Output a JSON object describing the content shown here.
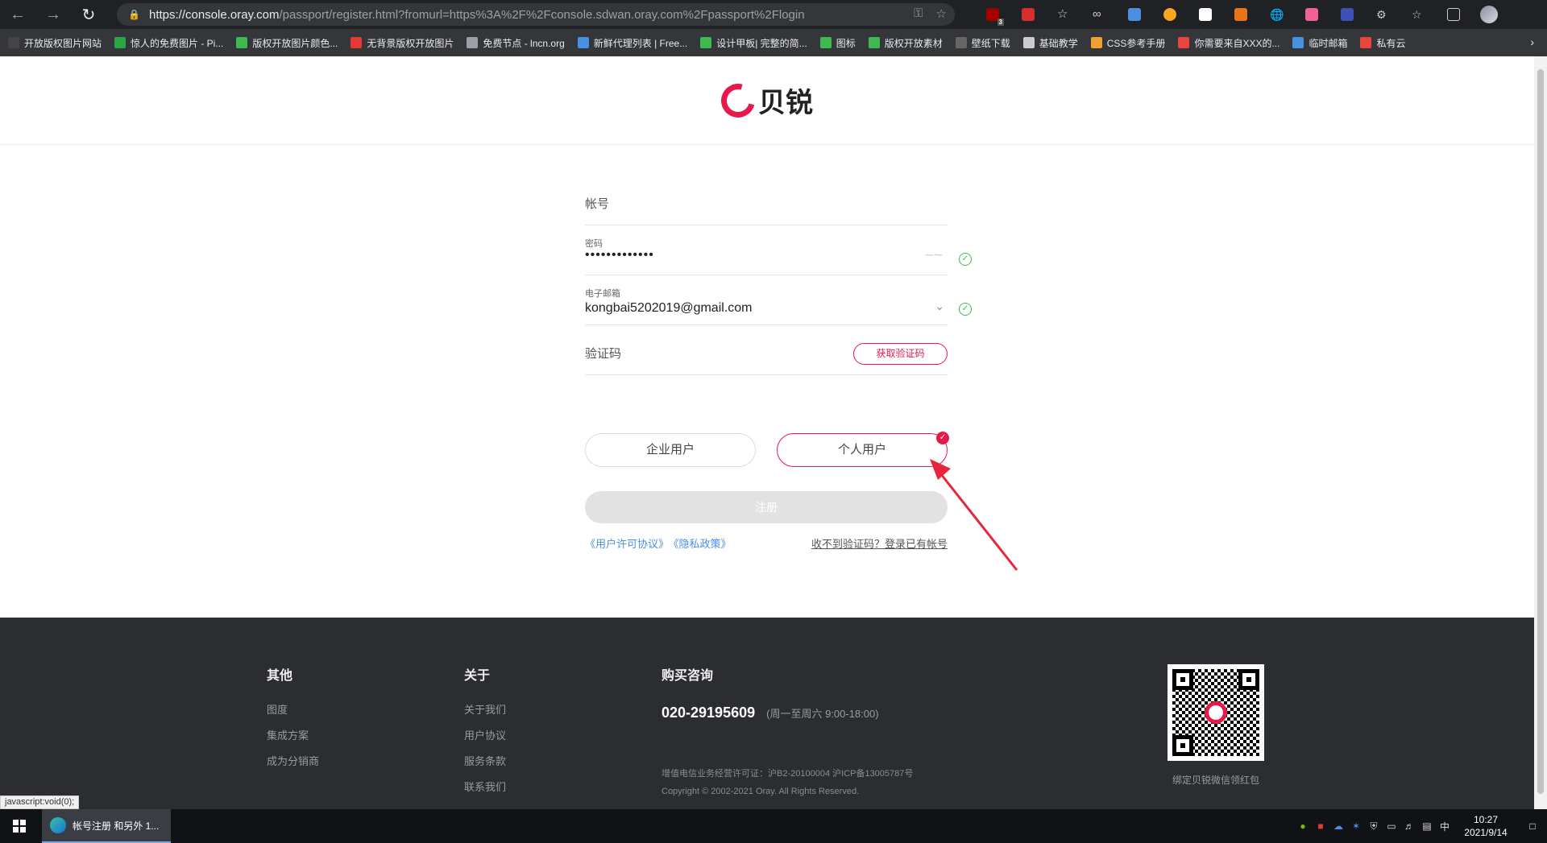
{
  "browser": {
    "url_host": "https://console.oray.com",
    "url_rest": "/passport/register.html?fromurl=https%3A%2F%2Fconsole.sdwan.oray.com%2Fpassport%2Flogin",
    "extension_badge": "3",
    "bookmarks": [
      {
        "label": "开放版权图片网站",
        "color": "#444"
      },
      {
        "label": "惊人的免费图片 - Pi...",
        "color": "#28a745"
      },
      {
        "label": "版权开放图片颜色...",
        "color": "#3fb950"
      },
      {
        "label": "无背景版权开放图片",
        "color": "#e53935"
      },
      {
        "label": "免费节点 - lncn.org",
        "color": "#9aa0a6"
      },
      {
        "label": "新鲜代理列表 | Free...",
        "color": "#4a90e2"
      },
      {
        "label": "设计甲板| 完整的简...",
        "color": "#3fb950"
      },
      {
        "label": "图标",
        "color": "#3fb950"
      },
      {
        "label": "版权开放素材",
        "color": "#3fb950"
      },
      {
        "label": "壁纸下载",
        "color": "#666"
      },
      {
        "label": "基础教学",
        "color": "#ccc"
      },
      {
        "label": "CSS参考手册",
        "color": "#f0a030"
      },
      {
        "label": "你需要来自XXX的...",
        "color": "#e8453c"
      },
      {
        "label": "临时邮箱",
        "color": "#4a90e2"
      },
      {
        "label": "私有云",
        "color": "#e8453c"
      }
    ]
  },
  "brand": {
    "name": "贝锐",
    "accent": "#e8194a"
  },
  "form": {
    "account_label": "帐号",
    "password_label": "密码",
    "password_value": "•••••••••••••",
    "email_label": "电子邮箱",
    "email_value": "kongbai5202019@gmail.com",
    "code_label": "验证码",
    "code_button": "获取验证码",
    "type_enterprise": "企业用户",
    "type_personal": "个人用户",
    "selected_type": "个人用户",
    "submit_label": "注册",
    "terms_link": "《用户许可协议》",
    "privacy_link": "《隐私政策》",
    "login_link": "收不到验证码？登录已有帐号"
  },
  "footer": {
    "col1_title": "其他",
    "col1_items": [
      "图度",
      "集成方案",
      "成为分销商"
    ],
    "col2_title": "关于",
    "col2_items": [
      "关于我们",
      "用户协议",
      "服务条款",
      "联系我们"
    ],
    "col3_title": "购买咨询",
    "phone": "020-29195609",
    "hours": "(周一至周六 9:00-18:00)",
    "license": "增值电信业务经营许可证：沪B2-20100004 沪ICP备13005787号",
    "copyright": "Copyright © 2002-2021 Oray. All Rights Reserved.",
    "qr_caption": "绑定贝锐微信领红包"
  },
  "status_bar": "javascript:void(0);",
  "taskbar": {
    "task_label": "帐号注册 和另外 1...",
    "ime": "中",
    "time": "10:27",
    "date": "2021/9/14"
  }
}
